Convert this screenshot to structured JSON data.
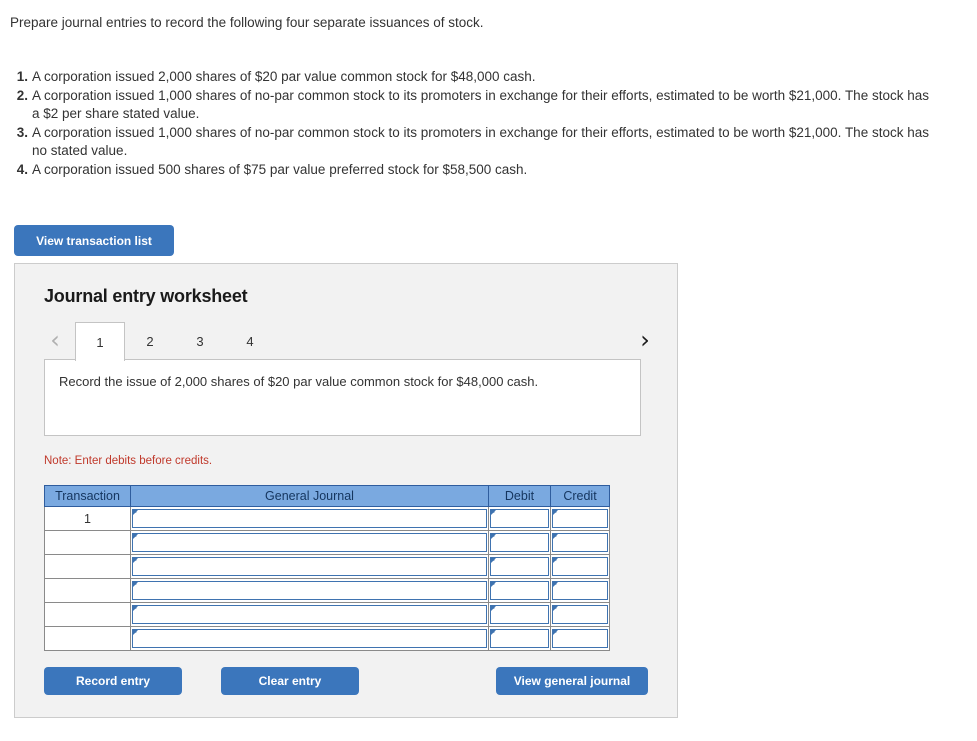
{
  "prompt": "Prepare journal entries to record the following four separate issuances of stock.",
  "requirements": [
    {
      "number": "1.",
      "text": "A corporation issued 2,000 shares of $20 par value common stock for $48,000 cash."
    },
    {
      "number": "2.",
      "text": "A corporation issued 1,000 shares of no-par common stock to its promoters in exchange for their efforts, estimated to be worth $21,000. The stock has a $2 per share stated value."
    },
    {
      "number": "3.",
      "text": "A corporation issued 1,000 shares of no-par common stock to its promoters in exchange for their efforts, estimated to be worth $21,000. The stock has no stated value."
    },
    {
      "number": "4.",
      "text": "A corporation issued 500 shares of $75 par value preferred stock for $58,500 cash."
    }
  ],
  "view_transaction_list_label": "View transaction list",
  "worksheet": {
    "title": "Journal entry worksheet",
    "prev_arrow": "‹",
    "next_arrow": "›",
    "tabs": [
      {
        "label": "1",
        "active": true
      },
      {
        "label": "2",
        "active": false
      },
      {
        "label": "3",
        "active": false
      },
      {
        "label": "4",
        "active": false
      }
    ],
    "description": "Record the issue of 2,000 shares of $20 par value common stock for $48,000 cash.",
    "note": "Note: Enter debits before credits.",
    "table": {
      "headers": [
        "Transaction",
        "General Journal",
        "Debit",
        "Credit"
      ],
      "rows": [
        {
          "transaction": "1",
          "general_journal": "",
          "debit": "",
          "credit": ""
        },
        {
          "transaction": "",
          "general_journal": "",
          "debit": "",
          "credit": ""
        },
        {
          "transaction": "",
          "general_journal": "",
          "debit": "",
          "credit": ""
        },
        {
          "transaction": "",
          "general_journal": "",
          "debit": "",
          "credit": ""
        },
        {
          "transaction": "",
          "general_journal": "",
          "debit": "",
          "credit": ""
        },
        {
          "transaction": "",
          "general_journal": "",
          "debit": "",
          "credit": ""
        }
      ]
    },
    "buttons": {
      "record_entry": "Record entry",
      "clear_entry": "Clear entry",
      "view_general_journal": "View general journal"
    }
  },
  "colors": {
    "button_blue": "#3b76bc",
    "table_header_blue": "#7aa9e0",
    "note_red": "#c0392b",
    "panel_background": "#f2f2f2"
  }
}
